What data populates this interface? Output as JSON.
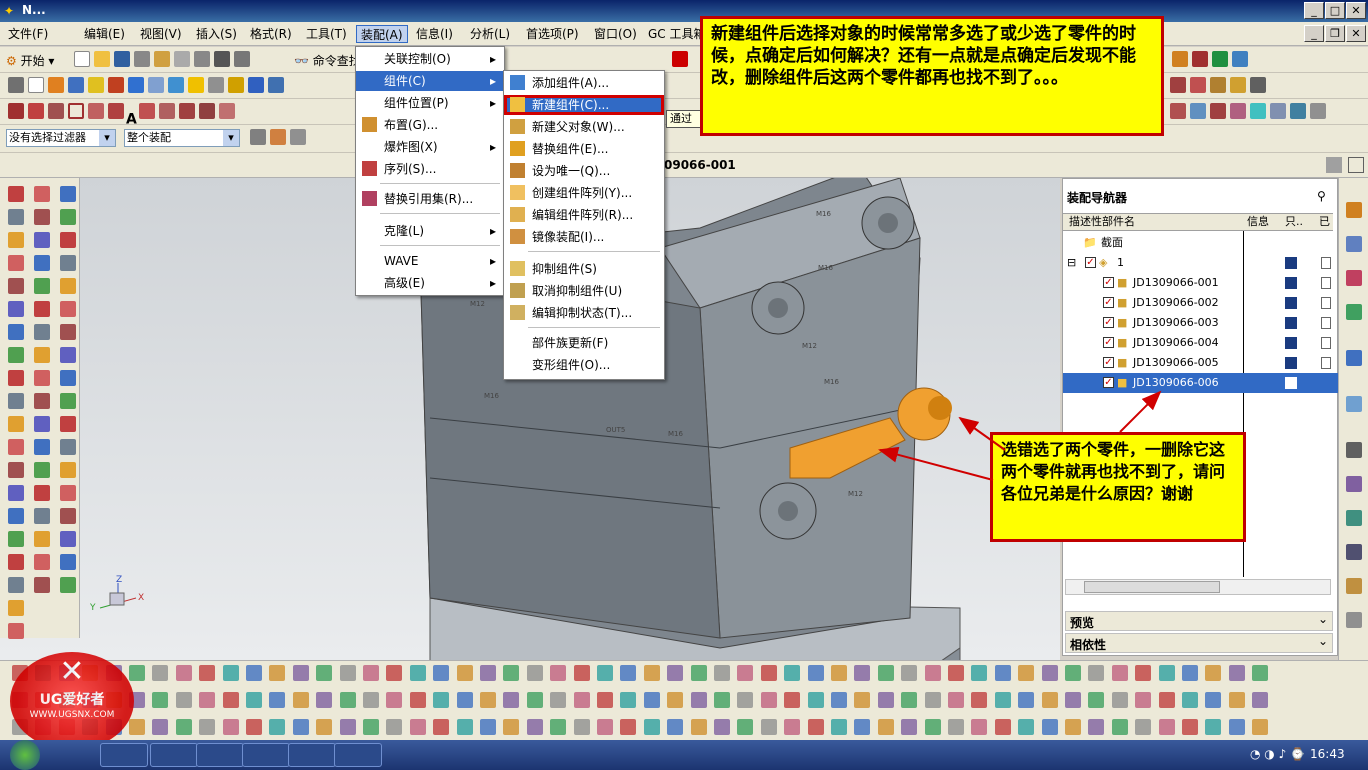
{
  "window": {
    "title": "N..."
  },
  "menubar": [
    {
      "label": "文件(F)"
    },
    {
      "label": "编辑(E)"
    },
    {
      "label": "视图(V)"
    },
    {
      "label": "插入(S)"
    },
    {
      "label": "格式(R)"
    },
    {
      "label": "工具(T)"
    },
    {
      "label": "装配(A)"
    },
    {
      "label": "信息(I)"
    },
    {
      "label": "分析(L)"
    },
    {
      "label": "首选项(P)"
    },
    {
      "label": "窗口(O)"
    },
    {
      "label": "GC 工具箱"
    }
  ],
  "toolbar": {
    "start_label": "开始",
    "command_finder": "命令查找",
    "filter_select": "没有选择过滤器",
    "assembly_select": "整个装配",
    "part_title": "09066-001",
    "tooltip": "通过"
  },
  "assembly_menu": [
    {
      "label": "关联控制(O)",
      "arrow": "▸"
    },
    {
      "label": "组件(C)",
      "arrow": "▸"
    },
    {
      "label": "组件位置(P)",
      "arrow": "▸"
    },
    {
      "label": "布置(G)..."
    },
    {
      "label": "爆炸图(X)",
      "arrow": "▸"
    },
    {
      "label": "序列(S)..."
    },
    {
      "label": "替换引用集(R)..."
    },
    {
      "label": "克隆(L)",
      "arrow": "▸"
    },
    {
      "label": "WAVE",
      "arrow": "▸"
    },
    {
      "label": "高级(E)",
      "arrow": "▸"
    }
  ],
  "component_menu": [
    {
      "label": "添加组件(A)..."
    },
    {
      "label": "新建组件(C)..."
    },
    {
      "label": "新建父对象(W)..."
    },
    {
      "label": "替换组件(E)..."
    },
    {
      "label": "设为唯一(Q)..."
    },
    {
      "label": "创建组件阵列(Y)..."
    },
    {
      "label": "编辑组件阵列(R)..."
    },
    {
      "label": "镜像装配(I)..."
    },
    {
      "label": "抑制组件(S)"
    },
    {
      "label": "取消抑制组件(U)"
    },
    {
      "label": "编辑抑制状态(T)..."
    },
    {
      "label": "部件族更新(F)"
    },
    {
      "label": "变形组件(O)..."
    }
  ],
  "navigator": {
    "title": "装配导航器",
    "columns": [
      "描述性部件名",
      "信息",
      "只..",
      "已"
    ],
    "rows": [
      {
        "name": "截面"
      },
      {
        "name": "1"
      },
      {
        "name": "JD1309066-001"
      },
      {
        "name": "JD1309066-002"
      },
      {
        "name": "JD1309066-003"
      },
      {
        "name": "JD1309066-004"
      },
      {
        "name": "JD1309066-005"
      },
      {
        "name": "JD1309066-006"
      }
    ],
    "preview": "预览",
    "dependency": "相依性"
  },
  "callouts": {
    "top": "新建组件后选择对象的时候常常多选了或少选了零件的时候，点确定后如何解决？还有一点就是点确定后发现不能改，删除组件后这两个零件都再也找不到了。。。",
    "right": "选错选了两个零件，一删除它这两个零件就再也找不到了，请问各位兄弟是什么原因？谢谢"
  },
  "model_labels": [
    "M16",
    "M16",
    "M16",
    "M12",
    "M16",
    "OUT5",
    "M16",
    "M12",
    "M12"
  ],
  "watermark": {
    "brand": "UG爱好者",
    "url": "WWW.UGSNX.COM"
  },
  "taskbar": {
    "time": "16:43"
  },
  "axis": {
    "x": "X",
    "y": "Y",
    "z": "Z"
  },
  "colors": {
    "accent": "#316ac5",
    "callout_bg": "#ffff00",
    "callout_border": "#c00000",
    "highlight_part": "#f0a030"
  }
}
